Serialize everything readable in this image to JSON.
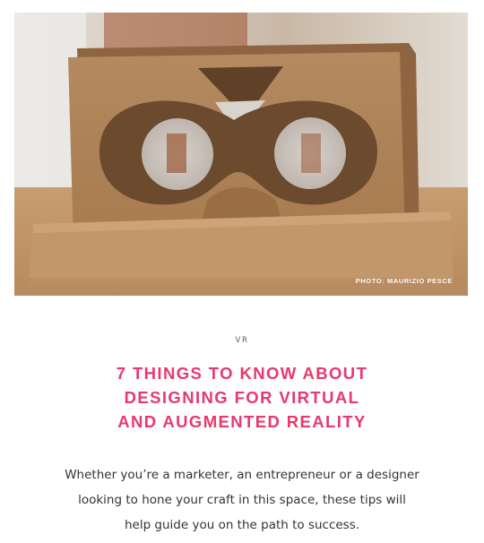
{
  "hero": {
    "image_description_icon": "cardboard-vr-viewer-photo",
    "credit": "PHOTO: MAURIZIO PESCE"
  },
  "article": {
    "category": "VR",
    "title_lines": [
      "7 THINGS TO KNOW ABOUT",
      "DESIGNING FOR VIRTUAL",
      "AND AUGMENTED REALITY"
    ],
    "summary_lines": [
      "Whether you’re a marketer, an entrepreneur or a designer",
      "looking to hone your craft in this space, these tips will",
      "help guide you on the path to success."
    ]
  },
  "colors": {
    "accent": "#e8396f",
    "text": "#333333",
    "category": "#5b5b5b",
    "background": "#ffffff"
  }
}
